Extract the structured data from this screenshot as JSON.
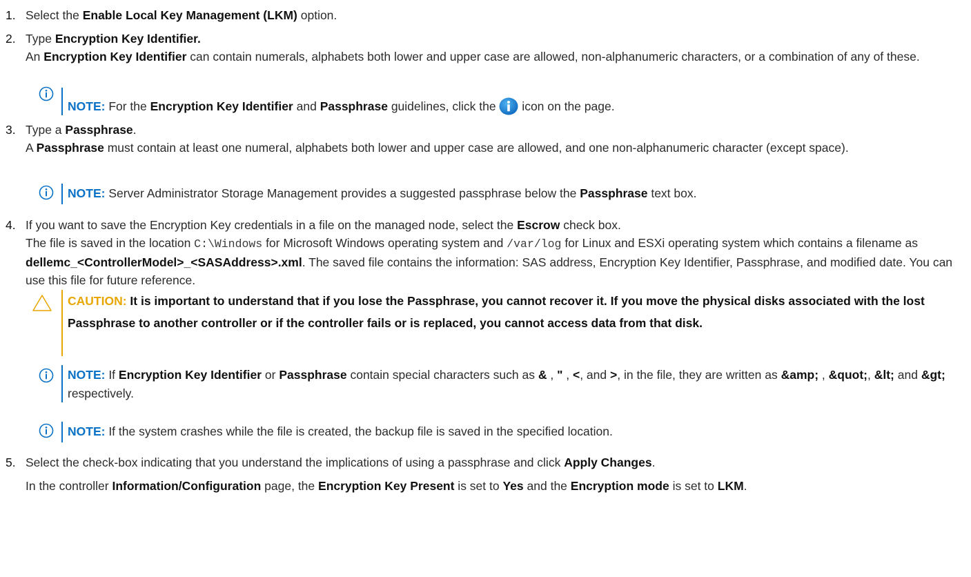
{
  "colors": {
    "note_accent": "#0a72c6",
    "caution_accent": "#e8a600",
    "info_badge": "#1582d6"
  },
  "steps": [
    {
      "num": "1.",
      "pre": "Select the ",
      "b1": "Enable Local Key Management (LKM)",
      "post": " option."
    },
    {
      "num": "2.",
      "title_pre": "Type ",
      "title_b": "Encryption Key Identifier.",
      "desc_pre": "An ",
      "desc_b": "Encryption Key Identifier",
      "desc_post": " can contain numerals, alphabets both lower and upper case are allowed, non-alphanumeric characters, or a combination of any of these."
    },
    {
      "num": "3.",
      "title_pre": "Type a ",
      "title_b": "Passphrase",
      "title_post": ".",
      "desc_pre": "A ",
      "desc_b": "Passphrase",
      "desc_post": " must contain at least one numeral, alphabets both lower and upper case are allowed, and one non-alphanumeric character (except space)."
    },
    {
      "num": "4.",
      "line1_pre": "If you want to save the Encryption Key credentials in a file on the managed node, select the ",
      "line1_b": "Escrow",
      "line1_post": " check box.",
      "p2_a": "The file is saved in the location ",
      "p2_code1": "C:\\Windows",
      "p2_b": " for Microsoft Windows operating system and ",
      "p2_code2": "/var/log",
      "p2_c": " for Linux and ESXi operating system which contains a filename as ",
      "p2_file": "dellemc_<ControllerModel>_<SASAddress>.xml",
      "p2_d": ". The saved file contains the information: SAS address, Encryption Key Identifier, Passphrase, and modified date. You can use this file for future reference."
    },
    {
      "num": "5.",
      "line1_pre": "Select the check-box indicating that you understand the implications of using a passphrase and click ",
      "line1_b": "Apply Changes",
      "line1_post": ".",
      "p2_a": "In the controller ",
      "p2_b1": "Information/Configuration",
      "p2_b": " page, the ",
      "p2_b2": "Encryption Key Present",
      "p2_c": " is set to ",
      "p2_b3": "Yes",
      "p2_d": " and the ",
      "p2_b4": "Encryption mode",
      "p2_e": " is set to ",
      "p2_b5": "LKM",
      "p2_f": "."
    }
  ],
  "notes": {
    "n1": {
      "label": "NOTE:",
      "pre": " For the ",
      "b1": "Encryption Key Identifier",
      "mid": " and ",
      "b2": "Passphrase",
      "post1": " guidelines, click the ",
      "post2": " icon on the page."
    },
    "n2": {
      "label": "NOTE:",
      "pre": " Server Administrator Storage Management provides a suggested passphrase below the ",
      "b1": "Passphrase",
      "post": " text box."
    },
    "caution": {
      "label": "CAUTION:",
      "text": " It is important to understand that if you lose the Passphrase, you cannot recover it. If you move the physical disks associated with the lost Passphrase to another controller or if the controller fails or is replaced, you cannot access data from that disk."
    },
    "n3": {
      "label": "NOTE:",
      "a": " If ",
      "b1": "Encryption Key Identifier",
      "b": " or ",
      "b2": "Passphrase",
      "c": " contain special characters such as ",
      "s1": "&",
      "sep1": " , ",
      "s2": "\"",
      "sep2": " , ",
      "s3": "<",
      "sep3": ", and ",
      "s4": ">",
      "d": ", in the file, they are written as ",
      "e1": "&amp;",
      "sep4": " , ",
      "e2": "&quot;",
      "sep5": ", ",
      "e3": "&lt;",
      "sep6": " and ",
      "e4": "&gt;",
      "e": " respectively."
    },
    "n4": {
      "label": "NOTE:",
      "text": " If the system crashes while the file is created, the backup file is saved in the specified location."
    }
  }
}
